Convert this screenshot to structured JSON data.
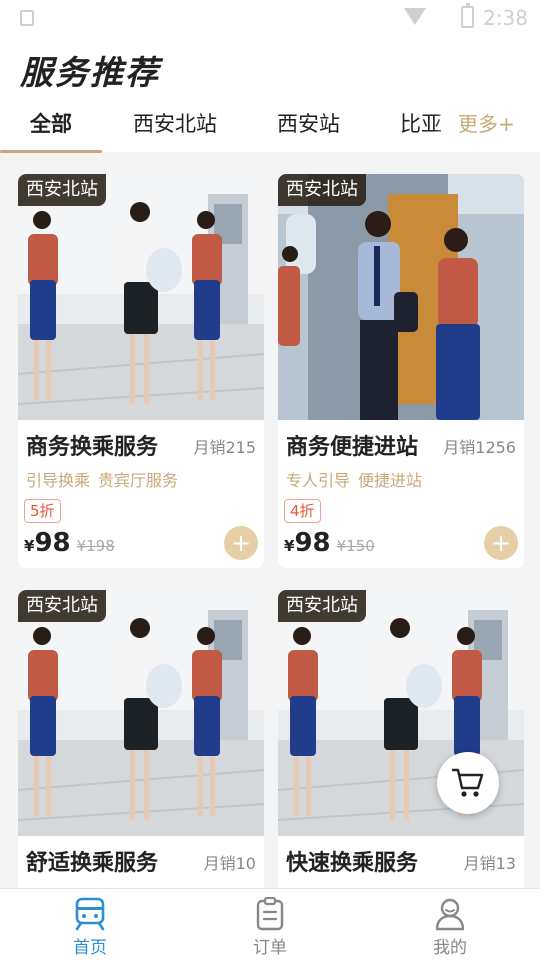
{
  "status_bar": {
    "time": "2:38"
  },
  "header": {
    "title": "服务推荐"
  },
  "tabs": [
    {
      "label": "全部",
      "active": true
    },
    {
      "label": "西安北站",
      "active": false
    },
    {
      "label": "西安站",
      "active": false
    },
    {
      "label": "比亚",
      "active": false
    }
  ],
  "more_tab": {
    "label": "更多+"
  },
  "products": [
    {
      "tag": "西安北站",
      "title": "商务换乘服务",
      "sales": "月销215",
      "features": [
        "引导换乘",
        "贵宾厅服务"
      ],
      "discount": "5折",
      "currency": "¥",
      "price": "98",
      "original_price": "¥198"
    },
    {
      "tag": "西安北站",
      "title": "商务便捷进站",
      "sales": "月销1256",
      "features": [
        "专人引导",
        "便捷进站"
      ],
      "discount": "4折",
      "currency": "¥",
      "price": "98",
      "original_price": "¥150"
    },
    {
      "tag": "西安北站",
      "title": "舒适换乘服务",
      "sales": "月销10"
    },
    {
      "tag": "西安北站",
      "title": "快速换乘服务",
      "sales": "月销13"
    }
  ],
  "cart": {
    "icon": "cart-icon"
  },
  "bottom_nav": [
    {
      "label": "首页",
      "icon": "train-icon",
      "active": true
    },
    {
      "label": "订单",
      "icon": "clipboard-icon",
      "active": false
    },
    {
      "label": "我的",
      "icon": "user-icon",
      "active": false
    }
  ],
  "colors": {
    "accent": "#c8a97a",
    "active_nav": "#2a8fd6",
    "discount": "#e8573c"
  }
}
